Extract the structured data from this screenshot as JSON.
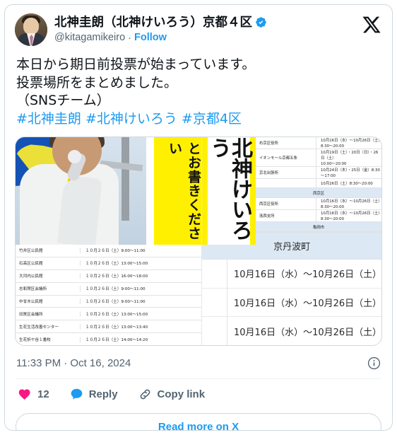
{
  "card": {
    "author": {
      "display_name": "北神圭朗（北神けいろう）京都４区",
      "handle": "@kitagamikeiro",
      "separator": "·",
      "follow_label": "Follow",
      "verified": true,
      "verified_color": "#1d9bf0"
    },
    "brand_icon": "x-logo-icon",
    "tweet": {
      "body": "本日から期日前投票が始まっています。\n投票場所をまとめました。\n（SNSチーム）",
      "hashtags": "#北神圭朗 #北神けいろう #京都4区"
    },
    "media": {
      "photo": {
        "sash_text": "北神け",
        "vertical_banner_text": "とお書きください",
        "poster_text": "北神けいろう"
      },
      "left_table": {
        "rows": [
          {
            "place": "竹井区公民館",
            "time": "１０月２６日（土）9:00～11:00"
          },
          {
            "place": "石高区公民館",
            "time": "１０月２６日（土）13:00～15:00"
          },
          {
            "place": "大河内公民館",
            "time": "１０月２６日（土）16:00～18:00"
          },
          {
            "place": "志和賀区会議所",
            "time": "１０月２６日（土）9:00～11:00"
          },
          {
            "place": "中甘木公民館",
            "time": "１０月２６日（土）9:00～11:00"
          },
          {
            "place": "旧質区会議所",
            "time": "１０月２６日（土）13:00～15:00"
          },
          {
            "place": "生花生活改善センター",
            "time": "１０月２６日（土）13:00～13:40"
          },
          {
            "place": "生花折ヤ谷１番校",
            "time": "１０月２６日（土）14:00～14:20"
          }
        ]
      },
      "right_table": {
        "rows": [
          {
            "type": "row",
            "place": "右京区役所",
            "time": "10月16日（水）～10月26日（土）8:30～20:00"
          },
          {
            "type": "row",
            "place": "イオンモール京都五条",
            "time": "10月19日（土）・20日（日）・26日（土）\n10:00～20:00"
          },
          {
            "type": "row",
            "place": "京北出張所",
            "time": "10月24日（木）・25日（金）8:30～17:00"
          },
          {
            "type": "row",
            "place": "",
            "time": "10月26日（土）8:30～20:00"
          },
          {
            "type": "section",
            "label": "西京区"
          },
          {
            "type": "row",
            "place": "西京区役所",
            "time": "10月16日（水）～10月26日（土）8:30～20:00"
          },
          {
            "type": "row",
            "place": "洛西支所",
            "time": "10月16日（水）～10月26日（土）8:30～20:00"
          },
          {
            "type": "section",
            "label": "亀岡市"
          }
        ],
        "big_section": "京丹波町",
        "big_rows": [
          "10月16日（水）～10月26日（土）",
          "10月16日（水）～10月26日（土）",
          "10月16日（水）～10月26日（土）"
        ]
      }
    },
    "timestamp": "11:33 PM · Oct 16, 2024",
    "info_icon": "info-circle-icon",
    "actions": {
      "like": {
        "icon": "heart-icon",
        "count": "12",
        "color": "#f91880"
      },
      "reply": {
        "icon": "speech-bubble-icon",
        "label": "Reply",
        "color": "#1d9bf0"
      },
      "copy_link": {
        "icon": "link-icon",
        "label": "Copy link"
      }
    },
    "read_more_label": "Read more on X",
    "accent_color": "#1d9bf0"
  }
}
